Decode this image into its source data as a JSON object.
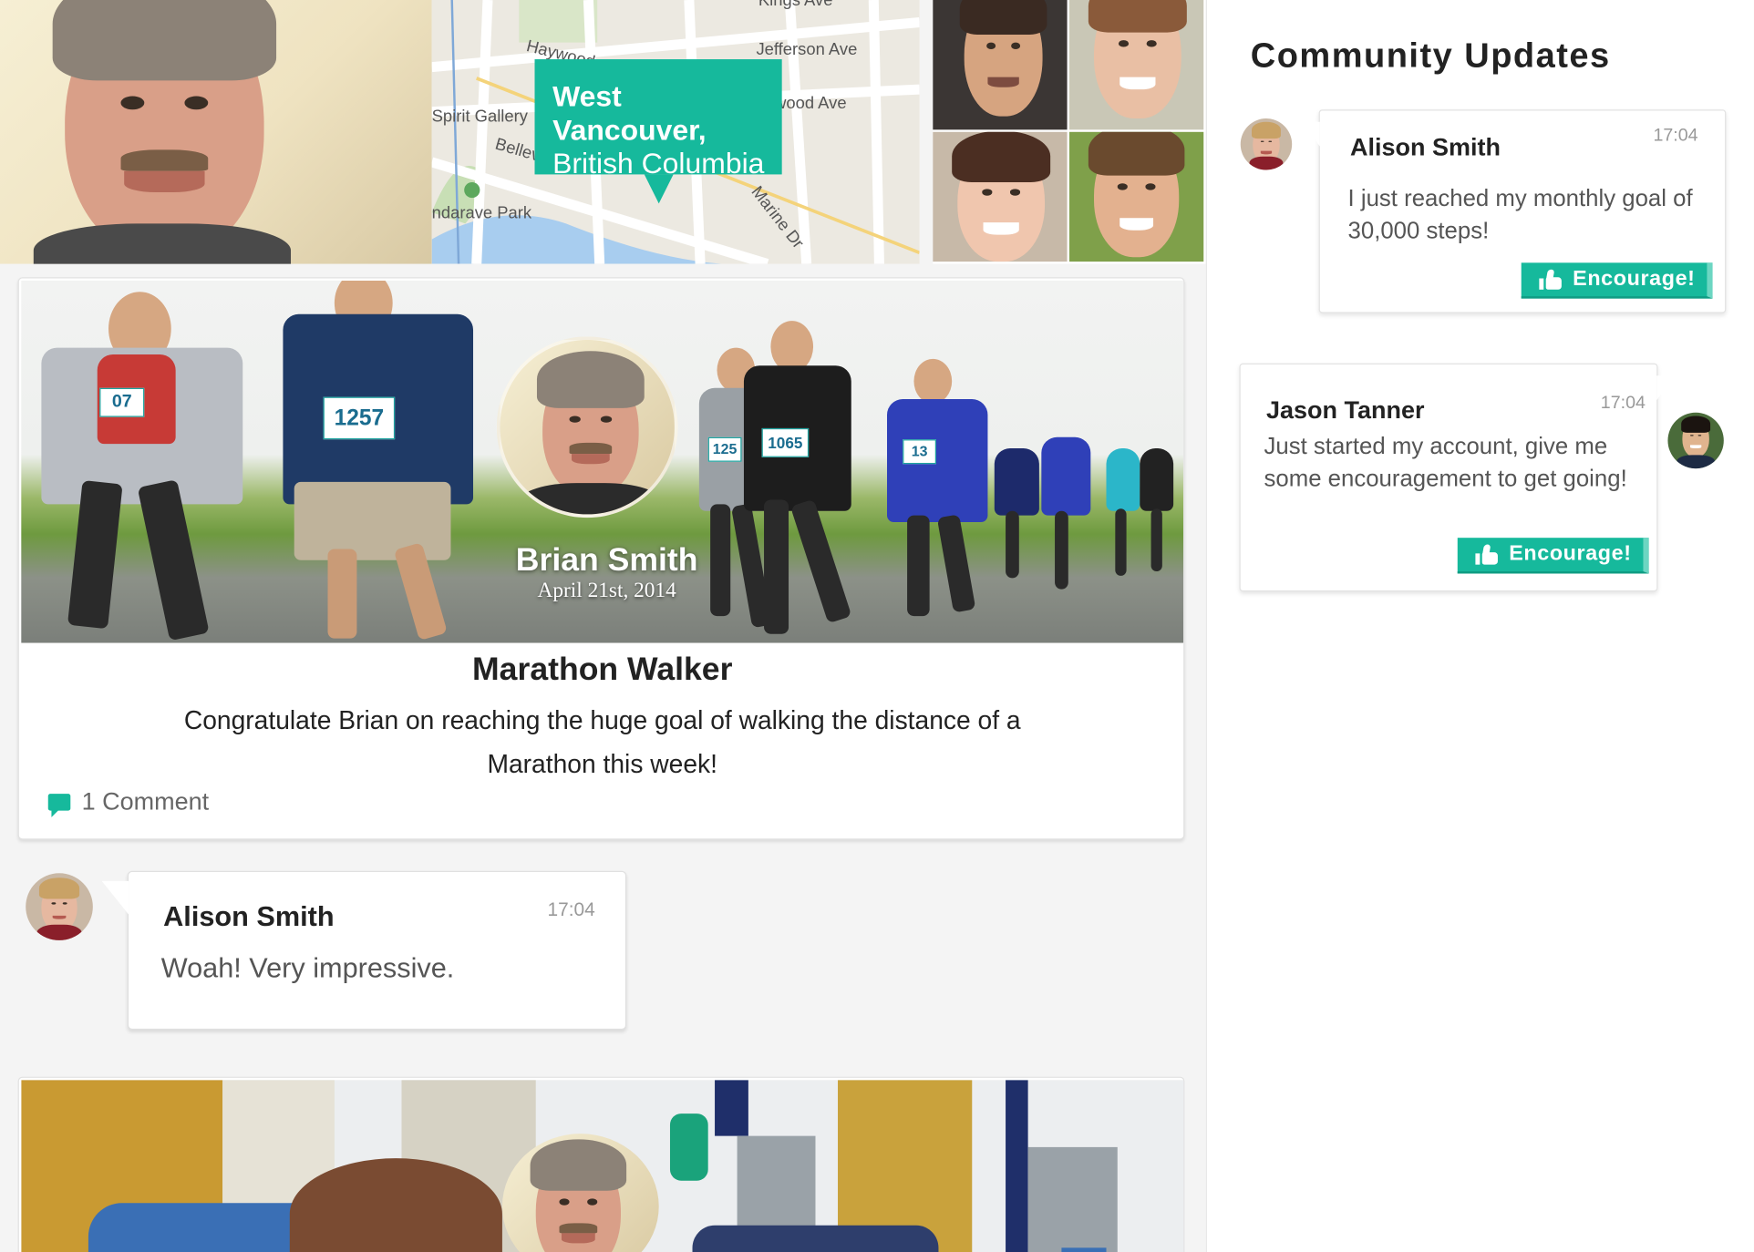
{
  "map": {
    "location_line1": "West Vancouver,",
    "location_line2": "British Columbia",
    "streets": [
      "Kings Ave",
      "Jefferson Ave",
      "Haywood",
      "Spirit Gallery",
      "Bellevue",
      "wood Ave",
      "Marine Dr",
      "ndarave Park"
    ]
  },
  "achievement": {
    "user_name": "Brian Smith",
    "date": "April 21st, 2014",
    "title": "Marathon Walker",
    "description": "Congratulate Brian on reaching the huge goal of walking the distance of a Marathon this week!",
    "comments_label": "1 Comment",
    "bibs": [
      "07",
      "1257",
      "125",
      "1065",
      "13"
    ]
  },
  "comment": {
    "author": "Alison Smith",
    "time": "17:04",
    "text": "Woah! Very impressive."
  },
  "community": {
    "heading": "Community Updates",
    "updates": [
      {
        "author": "Alison Smith",
        "time": "17:04",
        "text": "I just reached my monthly goal of 30,000 steps!",
        "button_label": "Encourage!"
      },
      {
        "author": "Jason Tanner",
        "time": "17:04",
        "text": "Just started my account, give me some encouragement to get going!",
        "button_label": "Encourage!"
      }
    ]
  },
  "colors": {
    "accent": "#16b99c",
    "background": "#f4f4f4"
  }
}
